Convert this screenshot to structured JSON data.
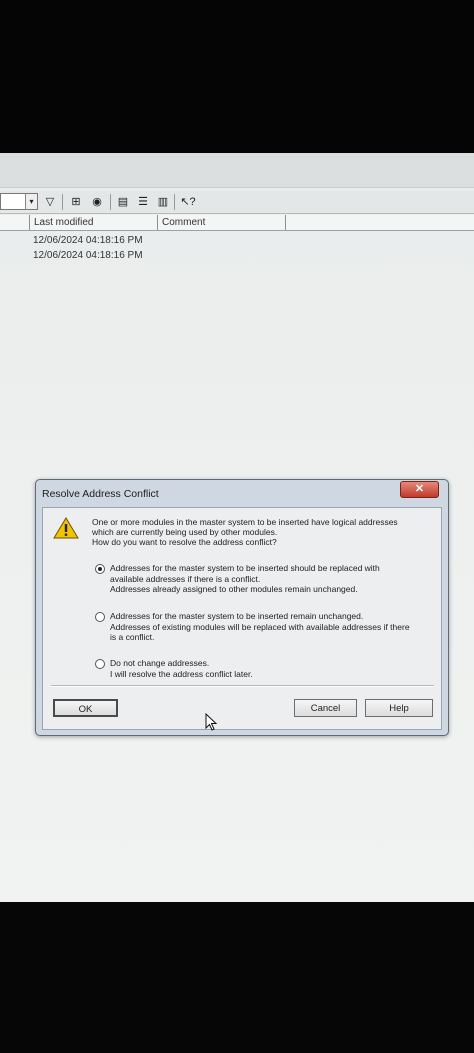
{
  "toolbar": {
    "dropdown_arrow": "▾",
    "icons": [
      "filter-icon",
      "network-view-icon",
      "module-icon",
      "window-icon",
      "list-view-icon",
      "details-view-icon",
      "help-icon"
    ],
    "glyphs": [
      "▽",
      "⊞",
      "◉",
      "▤",
      "☰",
      "▥",
      "↖?"
    ]
  },
  "columns": {
    "last_modified": "Last modified",
    "comment": "Comment"
  },
  "rows": [
    {
      "last_modified": "12/06/2024 04:18:16 PM"
    },
    {
      "last_modified": "12/06/2024 04:18:16 PM"
    }
  ],
  "dialog": {
    "title": "Resolve Address Conflict",
    "close_glyph": "✕",
    "message": [
      "One or more modules in the master system to be inserted have logical addresses",
      "which are currently being used by other modules.",
      "How do you want to resolve the address conflict?"
    ],
    "options": [
      {
        "selected": true,
        "lines": [
          "Addresses for the master system to be inserted should be replaced with",
          "available addresses if there is a conflict.",
          "Addresses already assigned to other modules remain unchanged."
        ]
      },
      {
        "selected": false,
        "lines": [
          "Addresses for the master system to be inserted remain unchanged.",
          "Addresses of existing modules will be replaced with available addresses if there",
          "is a conflict."
        ]
      },
      {
        "selected": false,
        "lines": [
          "Do not change addresses.",
          "I will resolve the address conflict later."
        ]
      }
    ],
    "buttons": {
      "ok": "OK",
      "cancel": "Cancel",
      "help": "Help"
    }
  },
  "colors": {
    "dialog_frame": "#cfd8e2",
    "close_button": "#c0392b",
    "warning": "#f2c300"
  }
}
